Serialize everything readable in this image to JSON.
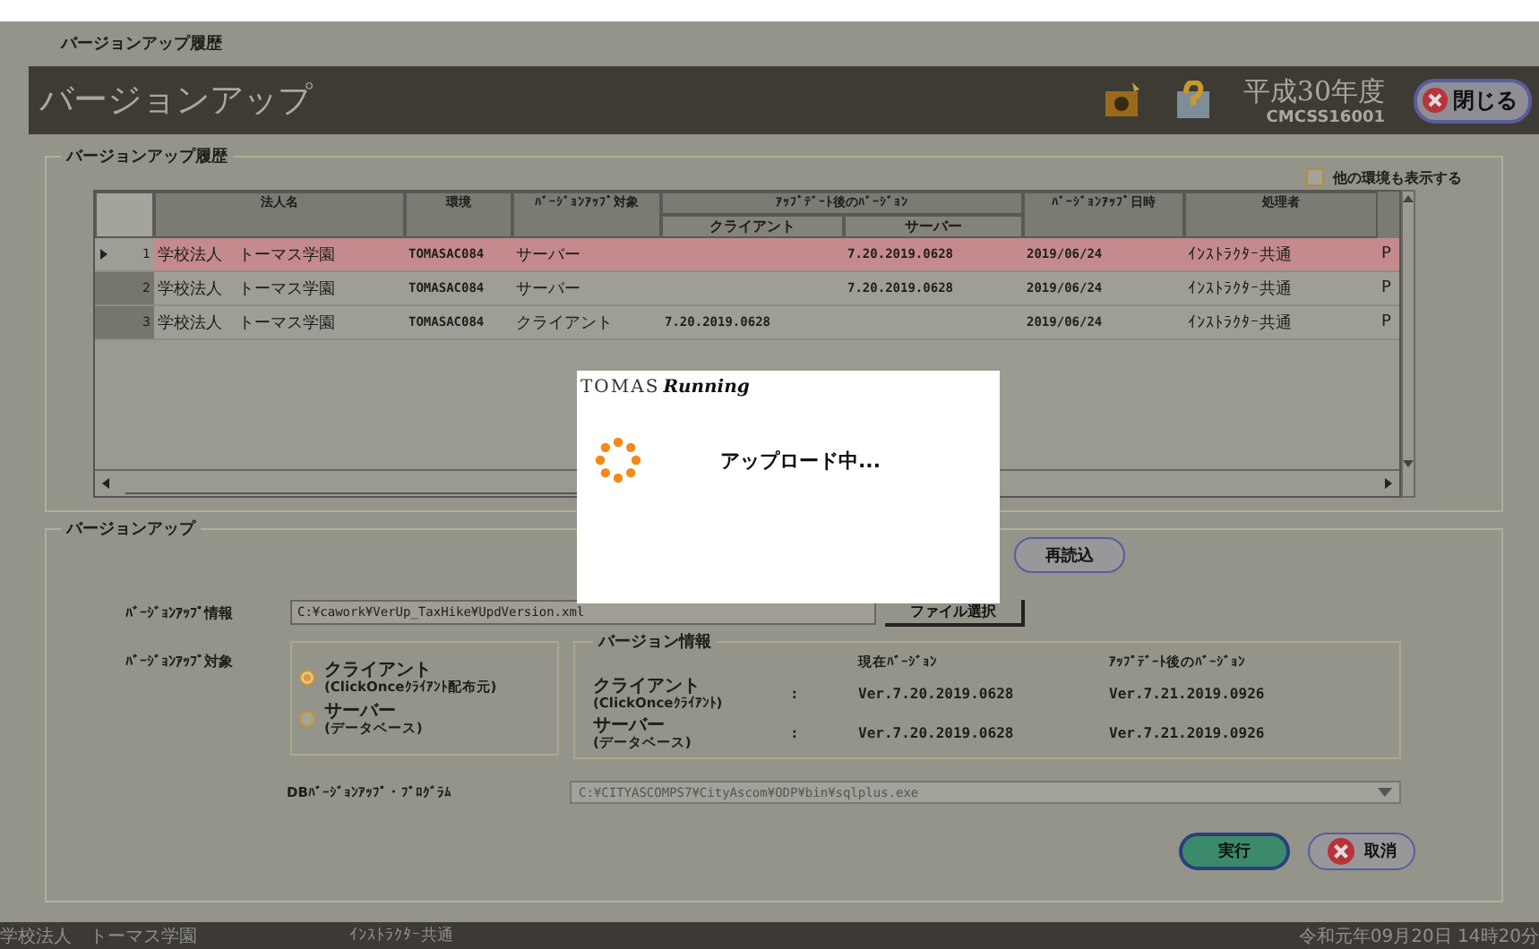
{
  "frame_legend": "バージョンアップ履歴",
  "header": {
    "title": "バージョンアップ",
    "year": "平成30年度",
    "screen_id": "CMCSS16001",
    "close_button": "閉じる"
  },
  "history": {
    "legend": "バージョンアップ履歴",
    "show_other_env": {
      "label": "他の環境も表示する",
      "checked": false
    },
    "columns": [
      {
        "label": "法人名"
      },
      {
        "label": "環境"
      },
      {
        "label": "ﾊﾞｰｼﾞｮﾝｱｯﾌﾟ対象"
      },
      {
        "label": "クライアント",
        "group": "ｱｯﾌﾟﾃﾞｰﾄ後のﾊﾞｰｼﾞｮﾝ"
      },
      {
        "label": "サーバー",
        "grouped": true
      },
      {
        "label": "ﾊﾞｰｼﾞｮﾝｱｯﾌﾟ日時"
      },
      {
        "label": "処理者"
      }
    ],
    "rows": [
      {
        "number": "1",
        "selected": true,
        "cells": [
          "学校法人　トーマス学園",
          "TOMASAC084",
          "サーバー",
          "",
          "7.20.2019.0628",
          "2019/06/24",
          "ｲﾝｽﾄﾗｸﾀｰ共通",
          "P"
        ]
      },
      {
        "number": "2",
        "selected": false,
        "cells": [
          "学校法人　トーマス学園",
          "TOMASAC084",
          "サーバー",
          "",
          "7.20.2019.0628",
          "2019/06/24",
          "ｲﾝｽﾄﾗｸﾀｰ共通",
          "P"
        ]
      },
      {
        "number": "3",
        "selected": false,
        "cells": [
          "学校法人　トーマス学園",
          "TOMASAC084",
          "クライアント",
          "7.20.2019.0628",
          "",
          "2019/06/24",
          "ｲﾝｽﾄﾗｸﾀｰ共通",
          "P"
        ]
      }
    ]
  },
  "versionup": {
    "legend": "バージョンアップ",
    "reload_button": "再読込",
    "info_label": "ﾊﾞｰｼﾞｮﾝｱｯﾌﾟ情報",
    "info_path": "C:¥cawork¥VerUp_TaxHike¥UpdVersion.xml",
    "file_button": "ファイル選択",
    "target_label": "ﾊﾞｰｼﾞｮﾝｱｯﾌﾟ対象",
    "targets": [
      {
        "label": "クライアント",
        "sub": "(ClickOnceｸﾗｲｱﾝﾄ配布元)",
        "selected": true
      },
      {
        "label": "サーバー",
        "sub": "(データベース)",
        "selected": false
      }
    ],
    "version_info": {
      "legend": "バージョン情報",
      "current_header": "現在ﾊﾞｰｼﾞｮﾝ",
      "updated_header": "ｱｯﾌﾟﾃﾞｰﾄ後のﾊﾞｰｼﾞｮﾝ",
      "rows": [
        {
          "label": "クライアント",
          "sub": "(ClickOnceｸﾗｲｱﾝﾄ)",
          "sep": ":",
          "current": "Ver.7.20.2019.0628",
          "updated": "Ver.7.21.2019.0926"
        },
        {
          "label": "サーバー",
          "sub": "(データベース)",
          "sep": ":",
          "current": "Ver.7.20.2019.0628",
          "updated": "Ver.7.21.2019.0926"
        }
      ]
    },
    "program_label": "DBﾊﾞｰｼﾞｮﾝｱｯﾌﾟ・ﾌﾟﾛｸﾞﾗﾑ",
    "program_path": "C:¥CITYASCOMPS7¥CityAscom¥ODP¥bin¥sqlplus.exe",
    "run_button": "実行",
    "cancel_button": "取消"
  },
  "dialog": {
    "logo_left": "TOMAS",
    "logo_right": "Running",
    "message": "アップロード中..."
  },
  "status_bar": {
    "corporation": "学校法人　トーマス学園",
    "user": "ｲﾝｽﾄﾗｸﾀｰ共通",
    "datetime": "令和元年09月20日 14時20分"
  }
}
